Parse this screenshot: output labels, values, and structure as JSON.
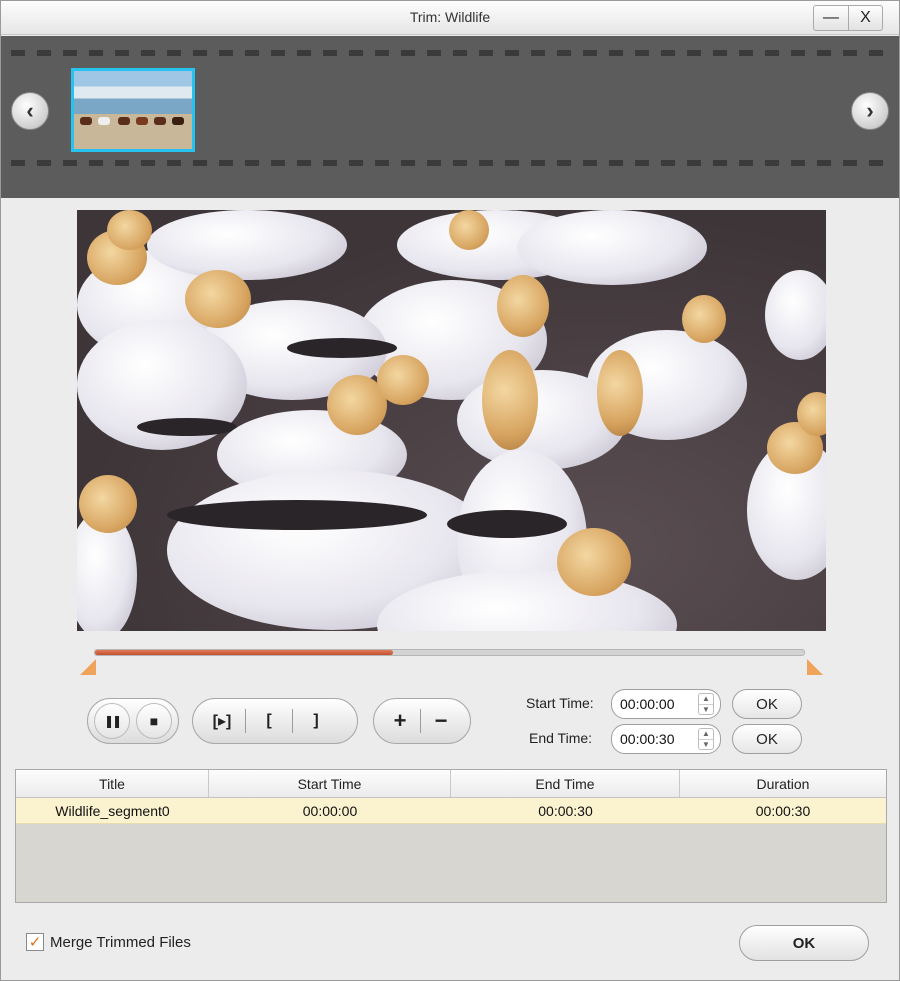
{
  "window": {
    "title": "Trim: Wildlife",
    "minimize_label": "—",
    "close_label": "X"
  },
  "filmstrip": {
    "prev_icon": "chevron-left-icon",
    "next_icon": "chevron-right-icon",
    "prev_label": "‹",
    "next_label": "›",
    "thumbnail_icon": "video-thumbnail"
  },
  "timeline": {
    "progress": 0.42
  },
  "playback": {
    "pause_icon": "pause-icon",
    "stop_icon": "stop-icon",
    "pause_label": "❚❚",
    "stop_label": "■",
    "play_segment_label": "[▸]",
    "set_start_label": "[",
    "set_end_label": "]",
    "add_label": "+",
    "remove_label": "−"
  },
  "trim": {
    "start_label": "Start Time:",
    "start_value": "00:00:00",
    "end_label": "End Time:",
    "end_value": "00:00:30",
    "ok_label": "OK"
  },
  "segments": {
    "columns": [
      "Title",
      "Start Time",
      "End Time",
      "Duration"
    ],
    "rows": [
      [
        "Wildlife_segment0",
        "00:00:00",
        "00:00:30",
        "00:00:30"
      ]
    ]
  },
  "footer": {
    "merge_label": "Merge Trimmed Files",
    "merge_checked": true,
    "check_glyph": "✓",
    "ok_label": "OK"
  },
  "colors": {
    "accent_timeline": "#c1502e",
    "marker": "#f0a35a",
    "thumbnail_border": "#26c3f0",
    "selected_row": "#fbf2cf"
  }
}
